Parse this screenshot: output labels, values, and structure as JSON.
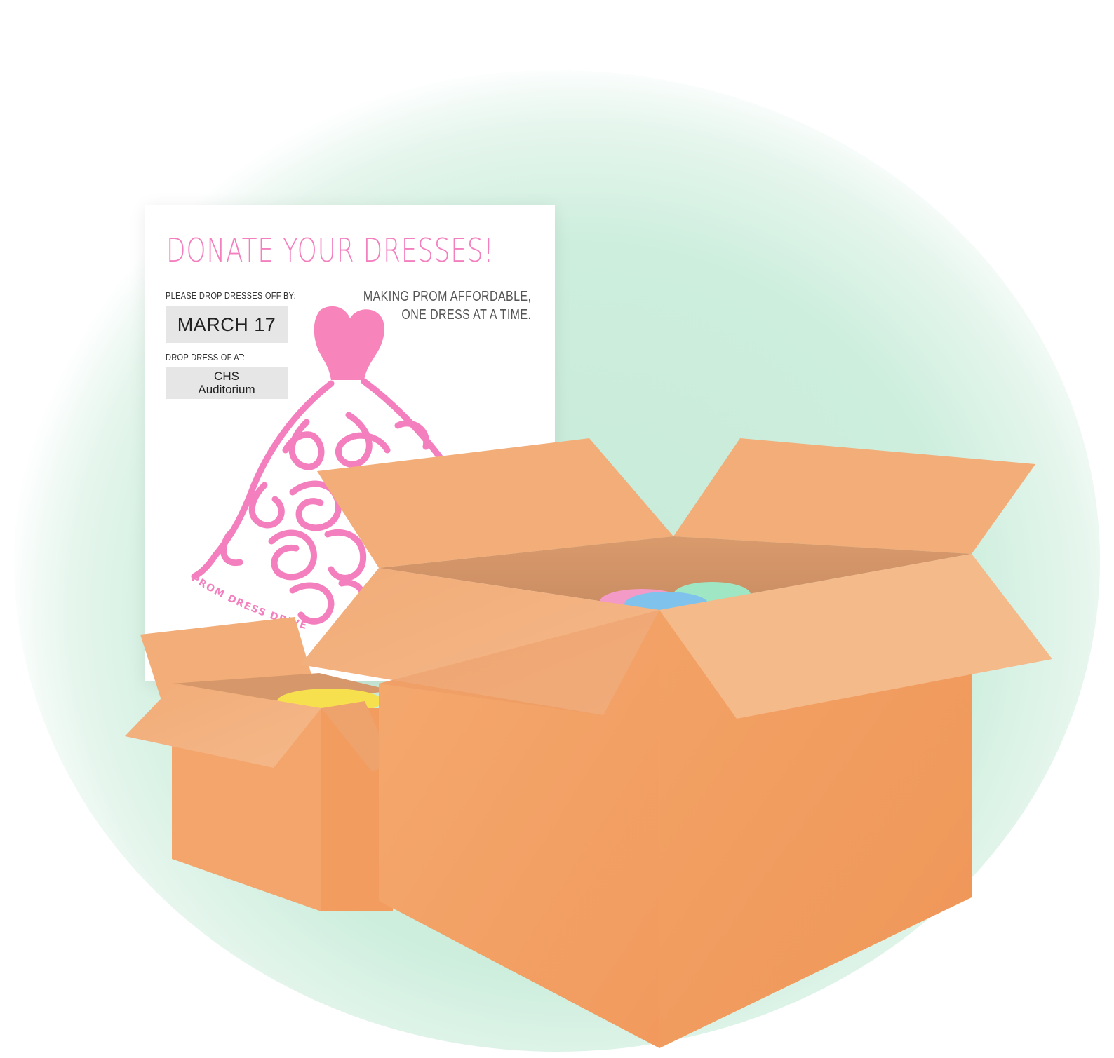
{
  "poster": {
    "title": "DONATE YOUR DRESSES!",
    "dropoff_label": "PLEASE DROP DRESSES OFF BY:",
    "date": "MARCH 17",
    "location_label": "DROP DRESS OF AT:",
    "location_line1": "CHS",
    "location_line2": "Auditorium",
    "tagline_line1": "MAKING PROM AFFORDABLE,",
    "tagline_line2": "ONE DRESS AT A TIME.",
    "dress_script_text": "Prom Dress",
    "dress_ribbon_text": "PROM DRESS DRIVE"
  },
  "colors": {
    "pink": "#f47fbf",
    "mint_glow": "#cdeedd",
    "cardboard": "#f2a468",
    "cardboard_light": "#f4b27e",
    "dress_pink": "#f39ac6",
    "dress_blue": "#7fc3ec",
    "dress_mint": "#9ee6c4",
    "dress_yellow": "#f7e04d"
  }
}
